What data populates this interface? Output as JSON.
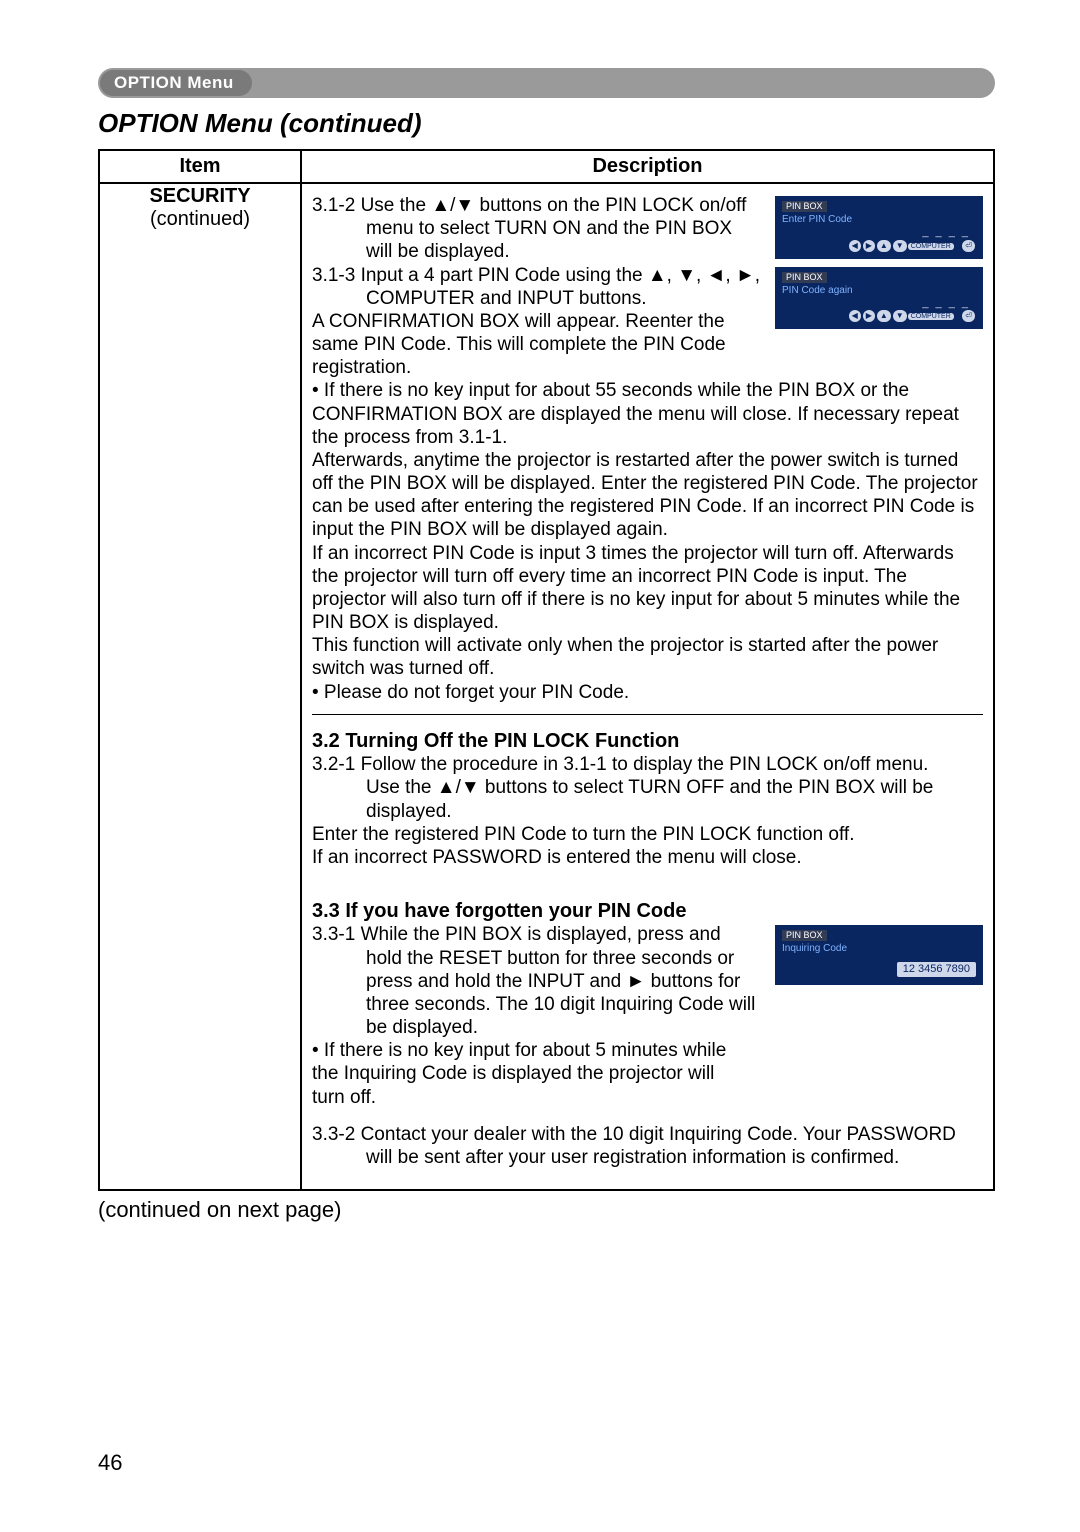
{
  "header": {
    "tab_label": "OPTION Menu",
    "section_title": "OPTION Menu (continued)"
  },
  "table": {
    "col_item": "Item",
    "col_desc": "Description",
    "item_name": "SECURITY",
    "item_sub": "(continued)"
  },
  "pinbox1": {
    "title": "PIN BOX",
    "sub": "Enter PIN Code",
    "dashes": "_ _ _ _",
    "computer": "COMPUTER",
    "left": "◀",
    "right": "▶",
    "up": "▲",
    "down": "▼",
    "enter": "⏎"
  },
  "pinbox2": {
    "title": "PIN BOX",
    "sub": "PIN Code again",
    "dashes": "_ _ _ _",
    "computer": "COMPUTER",
    "left": "◀",
    "right": "▶",
    "up": "▲",
    "down": "▼",
    "enter": "⏎"
  },
  "pinbox3": {
    "title": "PIN BOX",
    "sub": "Inquiring Code",
    "code": "12 3456 7890"
  },
  "desc": {
    "s312a": "3.1-2 Use the ▲/▼ buttons on the PIN LOCK on/off",
    "s312b": "menu to select TURN ON and the PIN BOX",
    "s312c": "will be displayed.",
    "s313a": "3.1-3  Input a 4 part PIN Code using the ▲, ▼, ◄, ►,",
    "s313b": "COMPUTER and INPUT buttons.",
    "s313c": "A CONFIRMATION BOX will appear. Reenter the",
    "s313d": "same PIN Code. This will complete the PIN Code",
    "s313e": "registration.",
    "b1": "• If there is no key input for about 55 seconds while the PIN BOX or the CONFIRMATION BOX are displayed the menu will close. If necessary repeat the process from 3.1-1.",
    "p1": "Afterwards, anytime the projector is restarted after the power switch is turned off the PIN BOX will be displayed. Enter the registered PIN Code. The projector can be used after entering the registered PIN Code. If an incorrect PIN Code is input the PIN BOX will be displayed again.",
    "p2": "If an incorrect PIN Code is input 3 times the projector will turn off. Afterwards the projector will turn off every time an incorrect PIN Code is input. The projector will also turn off if there is no key input for about 5 minutes while the PIN BOX is displayed.",
    "p3": "This function will activate only when the projector is started after the power switch was turned off.",
    "b2": "• Please do not forget your PIN Code.",
    "h32": "3.2 Turning Off the PIN LOCK Function",
    "s321a": "3.2-1 Follow the procedure in 3.1-1 to display the PIN LOCK on/off menu.",
    "s321b": "Use the ▲/▼ buttons to select TURN OFF and the PIN BOX will be",
    "s321c": "displayed.",
    "p32a": "Enter the registered PIN Code to turn the PIN LOCK function off.",
    "p32b": "If an incorrect PASSWORD is entered the menu will close.",
    "h33": "3.3 If you have forgotten your PIN Code",
    "s331a": "3.3-1 While the PIN BOX is displayed, press and",
    "s331b": "hold the RESET button for three seconds or",
    "s331c": "press and hold the INPUT and ► buttons for",
    "s331d": "three seconds. The 10 digit Inquiring Code will",
    "s331e": "be displayed.",
    "b33": "• If there is no key input for about 5 minutes while the Inquiring Code is displayed the projector will turn off.",
    "s332": "3.3-2 Contact your dealer with the 10 digit Inquiring Code. Your PASSWORD",
    "s332b": "will be sent after your user registration information is confirmed."
  },
  "footer": {
    "cont": "(continued on next page)",
    "page": "46"
  }
}
